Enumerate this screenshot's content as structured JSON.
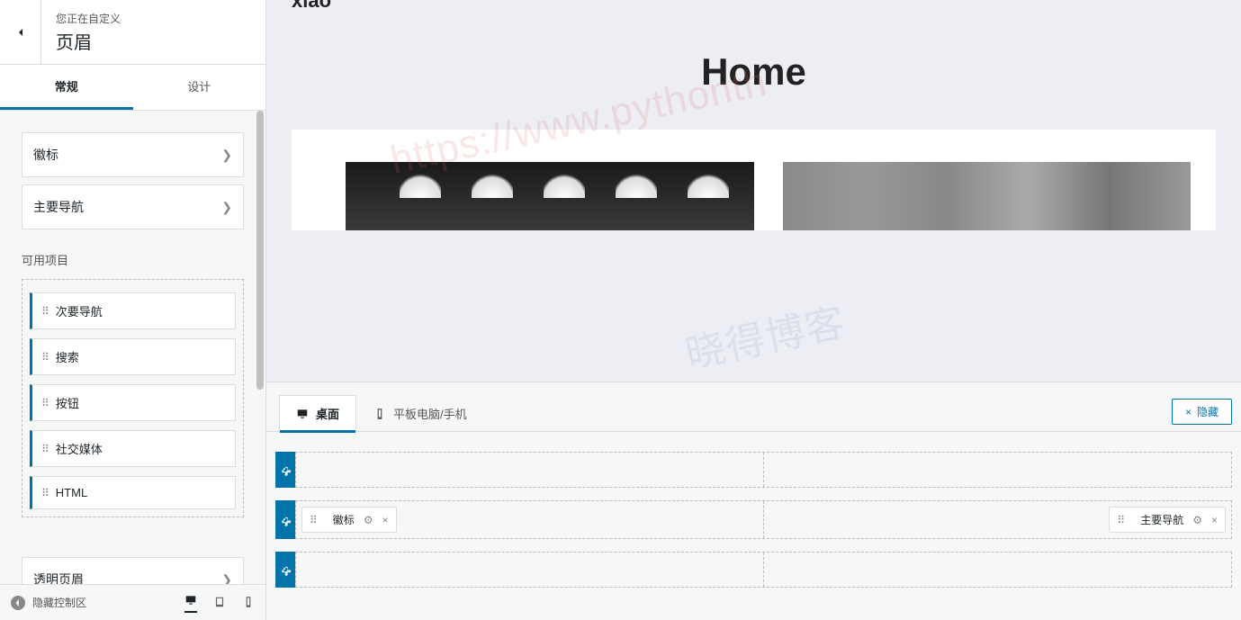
{
  "sidebar": {
    "subtitle": "您正在自定义",
    "title": "页眉",
    "tabs": {
      "general": "常规",
      "design": "设计"
    },
    "items": {
      "logo": "徽标",
      "primary_nav": "主要导航",
      "transparent": "透明页眉"
    },
    "available_label": "可用项目",
    "available": {
      "secondary_nav": "次要导航",
      "search": "搜索",
      "button": "按钮",
      "social": "社交媒体",
      "html": "HTML"
    },
    "hide_controls": "隐藏控制区"
  },
  "preview": {
    "logo": "xiao",
    "hero_title": "Home"
  },
  "builder": {
    "tabs": {
      "desktop": "桌面",
      "tablet": "平板电脑/手机"
    },
    "hide": "隐藏",
    "chips": {
      "logo": "徽标",
      "primary_nav": "主要导航"
    }
  },
  "watermark": {
    "part1": "https://www.pythonth",
    "part2": "晓得博客"
  }
}
